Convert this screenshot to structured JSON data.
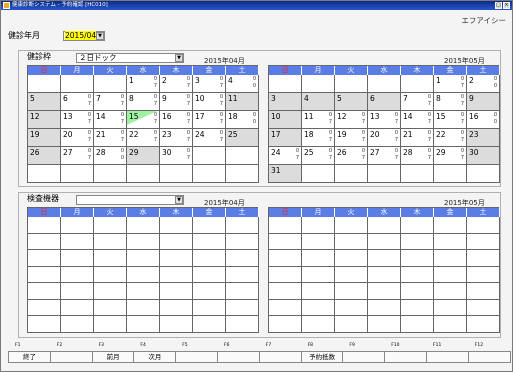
{
  "window": {
    "title": "健康診断システム - 予約確認 [HC010]",
    "icon_name": "app-icon",
    "close_label": "×",
    "max_label": "□"
  },
  "user": "エフアイシー",
  "exam_ym": {
    "label": "健診年月",
    "value": "2015/04"
  },
  "group1": {
    "label": "健診枠",
    "select_value": "２日ドック",
    "left": {
      "month": "2015年04月",
      "headers": [
        "日",
        "月",
        "火",
        "水",
        "木",
        "金",
        "土"
      ],
      "rows": [
        [
          {},
          {},
          {},
          {
            "d": "1",
            "a": "0",
            "b": "7"
          },
          {
            "d": "2",
            "a": "0",
            "b": "7"
          },
          {
            "d": "3",
            "a": "0",
            "b": "7"
          },
          {
            "d": "4",
            "a": "0",
            "b": "0"
          }
        ],
        [
          {
            "d": "5",
            "g": true
          },
          {
            "d": "6",
            "a": "0",
            "b": "7"
          },
          {
            "d": "7",
            "a": "0",
            "b": "7"
          },
          {
            "d": "8",
            "a": "0",
            "b": "7"
          },
          {
            "d": "9",
            "a": "0",
            "b": "7"
          },
          {
            "d": "10",
            "a": "0",
            "b": "7"
          },
          {
            "d": "11",
            "g": true
          }
        ],
        [
          {
            "d": "12",
            "g": true
          },
          {
            "d": "13",
            "a": "0",
            "b": "7"
          },
          {
            "d": "14",
            "a": "0",
            "b": "7"
          },
          {
            "d": "15",
            "a": "0",
            "b": "7",
            "sel": true
          },
          {
            "d": "16",
            "a": "0",
            "b": "7"
          },
          {
            "d": "17",
            "a": "0",
            "b": "7"
          },
          {
            "d": "18",
            "a": "0",
            "b": "0"
          }
        ],
        [
          {
            "d": "19",
            "g": true
          },
          {
            "d": "20",
            "a": "0",
            "b": "7"
          },
          {
            "d": "21",
            "a": "0",
            "b": "7"
          },
          {
            "d": "22",
            "a": "0",
            "b": "7"
          },
          {
            "d": "23",
            "a": "0",
            "b": "7"
          },
          {
            "d": "24",
            "a": "0",
            "b": "7"
          },
          {
            "d": "25",
            "g": true
          }
        ],
        [
          {
            "d": "26",
            "g": true
          },
          {
            "d": "27",
            "a": "0",
            "b": "7"
          },
          {
            "d": "28",
            "a": "0",
            "b": "0"
          },
          {
            "d": "29",
            "g": true
          },
          {
            "d": "30",
            "a": "0",
            "b": "7"
          },
          {},
          {}
        ],
        [
          {},
          {},
          {},
          {},
          {},
          {},
          {}
        ]
      ]
    },
    "right": {
      "month": "2015年05月",
      "headers": [
        "日",
        "月",
        "火",
        "水",
        "木",
        "金",
        "土"
      ],
      "rows": [
        [
          {},
          {},
          {},
          {},
          {},
          {
            "d": "1",
            "a": "0",
            "b": "7"
          },
          {
            "d": "2",
            "a": "0",
            "b": "0"
          }
        ],
        [
          {
            "d": "3",
            "g": true
          },
          {
            "d": "4",
            "g": true
          },
          {
            "d": "5",
            "g": true
          },
          {
            "d": "6",
            "g": true
          },
          {
            "d": "7",
            "a": "0",
            "b": "7"
          },
          {
            "d": "8",
            "a": "0",
            "b": "7"
          },
          {
            "d": "9",
            "g": true
          }
        ],
        [
          {
            "d": "10",
            "g": true
          },
          {
            "d": "11",
            "a": "0",
            "b": "7"
          },
          {
            "d": "12",
            "a": "0",
            "b": "7"
          },
          {
            "d": "13",
            "a": "0",
            "b": "7"
          },
          {
            "d": "14",
            "a": "0",
            "b": "7"
          },
          {
            "d": "15",
            "a": "0",
            "b": "7"
          },
          {
            "d": "16",
            "a": "0",
            "b": "0"
          }
        ],
        [
          {
            "d": "17",
            "g": true
          },
          {
            "d": "18",
            "a": "0",
            "b": "7"
          },
          {
            "d": "19",
            "a": "0",
            "b": "7"
          },
          {
            "d": "20",
            "a": "0",
            "b": "7"
          },
          {
            "d": "21",
            "a": "0",
            "b": "7"
          },
          {
            "d": "22",
            "a": "0",
            "b": "7"
          },
          {
            "d": "23",
            "g": true
          }
        ],
        [
          {
            "d": "24",
            "a": "0",
            "b": "7"
          },
          {
            "d": "25",
            "a": "0",
            "b": "7"
          },
          {
            "d": "26",
            "a": "0",
            "b": "7"
          },
          {
            "d": "27",
            "a": "0",
            "b": "7"
          },
          {
            "d": "28",
            "a": "0",
            "b": "7"
          },
          {
            "d": "29",
            "a": "0",
            "b": "7"
          },
          {
            "d": "30",
            "g": true
          }
        ],
        [
          {
            "d": "31",
            "g": true
          },
          {},
          {},
          {},
          {},
          {},
          {}
        ]
      ]
    }
  },
  "group2": {
    "label": "検査機器",
    "select_value": "",
    "left": {
      "month": "2015年04月",
      "headers": [
        "日",
        "月",
        "火",
        "水",
        "木",
        "金",
        "土"
      ]
    },
    "right": {
      "month": "2015年05月",
      "headers": [
        "日",
        "月",
        "火",
        "水",
        "木",
        "金",
        "土"
      ]
    }
  },
  "fkeys": [
    {
      "n": "F1",
      "label": "終了"
    },
    {
      "n": "F2",
      "label": ""
    },
    {
      "n": "F3",
      "label": "前月"
    },
    {
      "n": "F4",
      "label": "次月"
    },
    {
      "n": "F5",
      "label": ""
    },
    {
      "n": "F6",
      "label": ""
    },
    {
      "n": "F7",
      "label": ""
    },
    {
      "n": "F8",
      "label": "予約抵数"
    },
    {
      "n": "F9",
      "label": ""
    },
    {
      "n": "F10",
      "label": ""
    },
    {
      "n": "F11",
      "label": ""
    },
    {
      "n": "F12",
      "label": ""
    }
  ],
  "colors": {
    "header_bg": "#5a7de6",
    "sunday": "#ff2020",
    "holiday_cell": "#dcdcdc",
    "selected_highlight": "#9ff0a0",
    "year_month_highlight": "#ffff00"
  }
}
